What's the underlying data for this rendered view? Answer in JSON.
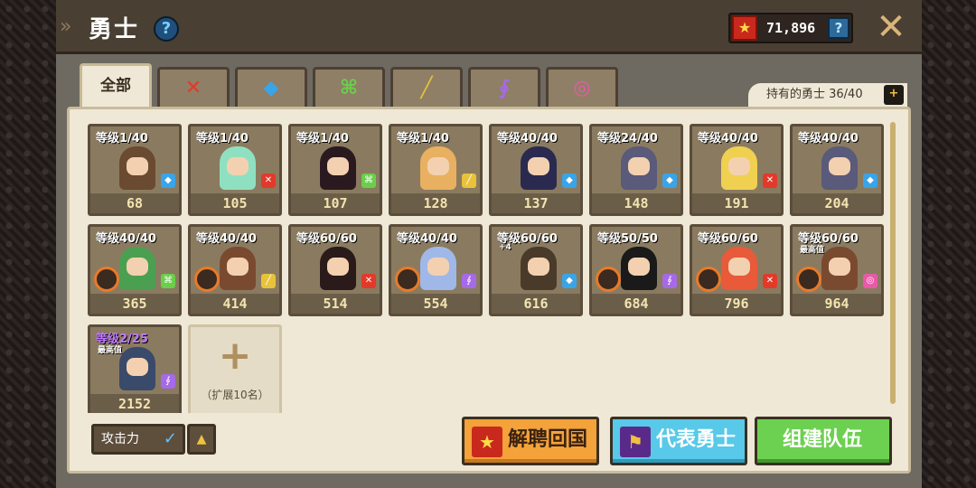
{
  "header": {
    "title": "勇士",
    "help_icon": "?",
    "currency_value": "71,896",
    "currency_help": "?",
    "close_icon": "✕"
  },
  "tabs": [
    {
      "label": "全部",
      "icon": "all",
      "active": true
    },
    {
      "label": "",
      "icon": "sword-icon",
      "color": "#e23a2a"
    },
    {
      "label": "",
      "icon": "hammer-icon",
      "color": "#3aa4e8"
    },
    {
      "label": "",
      "icon": "bow-icon",
      "color": "#6ad04a"
    },
    {
      "label": "",
      "icon": "gun-icon",
      "color": "#e8c23a"
    },
    {
      "label": "",
      "icon": "staff-icon",
      "color": "#a66ae8"
    },
    {
      "label": "",
      "icon": "orb-icon",
      "color": "#e85aa8"
    }
  ],
  "owned": {
    "label": "持有的勇士 36/40",
    "plus": "+"
  },
  "heroes": [
    {
      "level": "等级1/40",
      "power": "68",
      "hair": "#6a4a30",
      "weapon": "hammer",
      "badge_color": "#3aa4e8"
    },
    {
      "level": "等级1/40",
      "power": "105",
      "hair": "#8fe0c0",
      "weapon": "sword",
      "badge_color": "#e23a2a"
    },
    {
      "level": "等级1/40",
      "power": "107",
      "hair": "#2a1a20",
      "weapon": "bow",
      "badge_color": "#6ad04a",
      "flag": true
    },
    {
      "level": "等级1/40",
      "power": "128",
      "hair": "#e8b060",
      "weapon": "gun",
      "badge_color": "#e8c23a"
    },
    {
      "level": "等级40/40",
      "power": "137",
      "hair": "#2a2a50",
      "weapon": "hammer",
      "badge_color": "#3aa4e8"
    },
    {
      "level": "等级24/40",
      "power": "148",
      "hair": "#5a5a7a",
      "weapon": "hammer",
      "badge_color": "#3aa4e8"
    },
    {
      "level": "等级40/40",
      "power": "191",
      "hair": "#f0d050",
      "weapon": "sword",
      "badge_color": "#e23a2a"
    },
    {
      "level": "等级40/40",
      "power": "204",
      "hair": "#5a5a7a",
      "weapon": "hammer",
      "badge_color": "#3aa4e8"
    },
    {
      "level": "等级40/40",
      "power": "365",
      "hair": "#4aa050",
      "weapon": "bow",
      "badge_color": "#6ad04a",
      "ring": true
    },
    {
      "level": "等级40/40",
      "power": "414",
      "hair": "#7a4a30",
      "weapon": "gun",
      "badge_color": "#e8c23a",
      "ring": true
    },
    {
      "level": "等级60/60",
      "power": "514",
      "hair": "#2a1a1a",
      "weapon": "sword",
      "badge_color": "#e23a2a"
    },
    {
      "level": "等级40/40",
      "power": "554",
      "hair": "#a0b8e8",
      "weapon": "staff",
      "badge_color": "#a66ae8",
      "ring": true
    },
    {
      "level": "等级60/60",
      "power": "616",
      "hair": "#4a3a2a",
      "weapon": "hammer",
      "badge_color": "#3aa4e8",
      "note": "+4"
    },
    {
      "level": "等级50/50",
      "power": "684",
      "hair": "#1a1a1a",
      "weapon": "staff",
      "badge_color": "#a66ae8",
      "ring": true
    },
    {
      "level": "等级60/60",
      "power": "796",
      "hair": "#e85a3a",
      "weapon": "sword",
      "badge_color": "#e23a2a",
      "ring": true
    },
    {
      "level": "等级60/60",
      "power": "964",
      "hair": "#7a4a30",
      "weapon": "orb",
      "badge_color": "#e85aa8",
      "ring": true,
      "note": "最高值"
    },
    {
      "level": "等级2/25",
      "power": "2152",
      "hair": "#3a4a6a",
      "weapon": "staff",
      "badge_color": "#a66ae8",
      "purple": true,
      "note": "最高值"
    }
  ],
  "expand": {
    "plus": "+",
    "label": "（扩展10名）"
  },
  "controls": {
    "sort_label": "攻击力",
    "sort_check": "✓",
    "sort_order": "▲",
    "release_label": "解聘回国",
    "representative_label": "代表勇士",
    "team_label": "组建队伍"
  },
  "colors": {
    "accent": "#f0c040",
    "panel": "#efe8d6"
  }
}
